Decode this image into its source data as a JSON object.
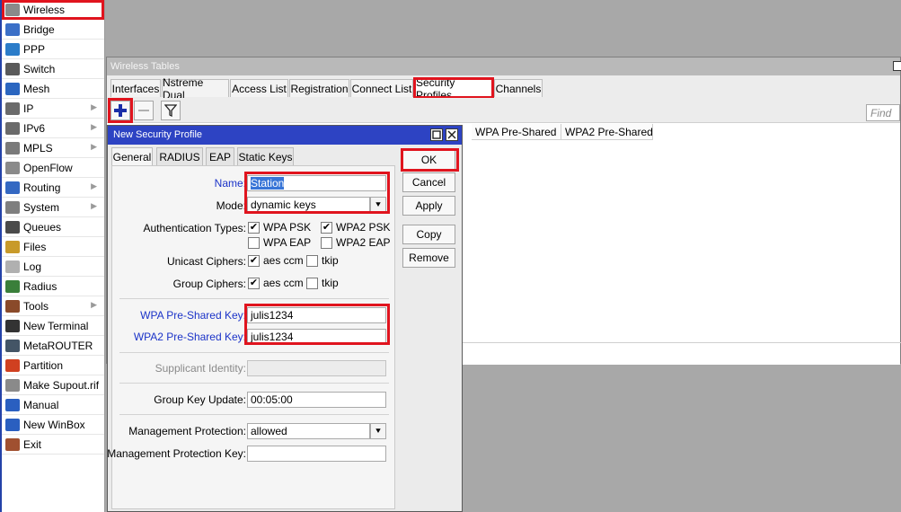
{
  "sidebar": {
    "items": [
      {
        "label": "Wireless",
        "icon": "wireless-icon",
        "submenu": false
      },
      {
        "label": "Bridge",
        "icon": "bridge-icon",
        "submenu": false
      },
      {
        "label": "PPP",
        "icon": "ppp-icon",
        "submenu": false
      },
      {
        "label": "Switch",
        "icon": "switch-icon",
        "submenu": false
      },
      {
        "label": "Mesh",
        "icon": "mesh-icon",
        "submenu": false
      },
      {
        "label": "IP",
        "icon": "ip-icon",
        "submenu": true
      },
      {
        "label": "IPv6",
        "icon": "ipv6-icon",
        "submenu": true
      },
      {
        "label": "MPLS",
        "icon": "mpls-icon",
        "submenu": true
      },
      {
        "label": "OpenFlow",
        "icon": "openflow-icon",
        "submenu": false
      },
      {
        "label": "Routing",
        "icon": "routing-icon",
        "submenu": true
      },
      {
        "label": "System",
        "icon": "system-icon",
        "submenu": true
      },
      {
        "label": "Queues",
        "icon": "queues-icon",
        "submenu": false
      },
      {
        "label": "Files",
        "icon": "files-icon",
        "submenu": false
      },
      {
        "label": "Log",
        "icon": "log-icon",
        "submenu": false
      },
      {
        "label": "Radius",
        "icon": "radius-icon",
        "submenu": false
      },
      {
        "label": "Tools",
        "icon": "tools-icon",
        "submenu": true
      },
      {
        "label": "New Terminal",
        "icon": "terminal-icon",
        "submenu": false
      },
      {
        "label": "MetaROUTER",
        "icon": "metarouter-icon",
        "submenu": false
      },
      {
        "label": "Partition",
        "icon": "partition-icon",
        "submenu": false
      },
      {
        "label": "Make Supout.rif",
        "icon": "supout-icon",
        "submenu": false
      },
      {
        "label": "Manual",
        "icon": "manual-icon",
        "submenu": false
      },
      {
        "label": "New WinBox",
        "icon": "winbox-icon",
        "submenu": false
      },
      {
        "label": "Exit",
        "icon": "exit-icon",
        "submenu": false
      }
    ]
  },
  "wireless_tables": {
    "title": "Wireless Tables",
    "tabs": [
      "Interfaces",
      "Nstreme Dual",
      "Access List",
      "Registration",
      "Connect List",
      "Security Profiles",
      "Channels"
    ],
    "selected_tab": "Security Profiles",
    "find_placeholder": "Find",
    "columns": [
      "WPA Pre-Shared ...",
      "WPA2 Pre-Shared..."
    ]
  },
  "dialog": {
    "title": "New Security Profile",
    "tabs": [
      "General",
      "RADIUS",
      "EAP",
      "Static Keys"
    ],
    "selected_tab": "General",
    "name_label": "Name:",
    "name_value": "Station",
    "mode_label": "Mode:",
    "mode_value": "dynamic keys",
    "auth_label": "Authentication Types:",
    "auth_options": [
      {
        "label": "WPA PSK",
        "checked": true
      },
      {
        "label": "WPA2 PSK",
        "checked": true
      },
      {
        "label": "WPA EAP",
        "checked": false
      },
      {
        "label": "WPA2 EAP",
        "checked": false
      }
    ],
    "unicast_label": "Unicast Ciphers:",
    "unicast_options": [
      {
        "label": "aes ccm",
        "checked": true
      },
      {
        "label": "tkip",
        "checked": false
      }
    ],
    "group_label": "Group Ciphers:",
    "group_options": [
      {
        "label": "aes ccm",
        "checked": true
      },
      {
        "label": "tkip",
        "checked": false
      }
    ],
    "wpa_key_label": "WPA Pre-Shared Key:",
    "wpa_key_value": "julis1234",
    "wpa2_key_label": "WPA2 Pre-Shared Key:",
    "wpa2_key_value": "julis1234",
    "supplicant_label": "Supplicant Identity:",
    "supplicant_value": "",
    "gku_label": "Group Key Update:",
    "gku_value": "00:05:00",
    "mgmt_label": "Management Protection:",
    "mgmt_value": "allowed",
    "mgmt_key_label": "Management Protection Key:",
    "mgmt_key_value": "",
    "buttons": {
      "ok": "OK",
      "cancel": "Cancel",
      "apply": "Apply",
      "copy": "Copy",
      "remove": "Remove"
    }
  },
  "colors": {
    "highlight": "#e0141e",
    "dialog_title": "#2d43c3",
    "blue_label": "#1b33c8"
  }
}
